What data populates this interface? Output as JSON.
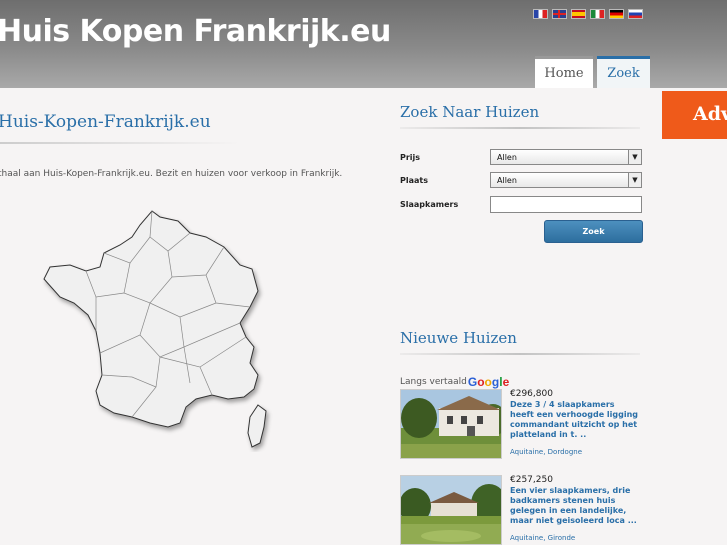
{
  "header": {
    "site_title": "Huis Kopen Frankrijk.eu",
    "languages": [
      "fr-flag-icon",
      "en-flag-icon",
      "es-flag-icon",
      "it-flag-icon",
      "de-flag-icon",
      "ru-flag-icon"
    ],
    "tabs": [
      {
        "label": "Home"
      },
      {
        "label": "Zoek"
      }
    ]
  },
  "ad": {
    "label": "Adv"
  },
  "left": {
    "title": "Huis-Kopen-Frankrijk.eu",
    "intro": "thaal aan Huis-Kopen-Frankrijk.eu. Bezit en huizen voor verkoop in Frankrijk."
  },
  "search": {
    "title": "Zoek Naar Huizen",
    "prijs_label": "Prijs",
    "prijs_value": "Allen",
    "plaats_label": "Plaats",
    "plaats_value": "Allen",
    "slaapkamers_label": "Slaapkamers",
    "button_label": "Zoek"
  },
  "new_houses": {
    "title": "Nieuwe Huizen",
    "translated_label": "Langs vertaald",
    "listings": [
      {
        "price": "€296,800",
        "description": "Deze 3 / 4 slaapkamers heeft een verhoogde ligging commandant uitzicht op het platteland in t. ..",
        "location": "Aquitaine, Dordogne"
      },
      {
        "price": "€257,250",
        "description": "Een vier slaapkamers, drie badkamers stenen huis gelegen in een landelijke, maar niet geisoleerd loca ...",
        "location": "Aquitaine, Gironde"
      }
    ]
  },
  "colors": {
    "accent": "#2a6fa8",
    "ad": "#ef5a1a"
  }
}
